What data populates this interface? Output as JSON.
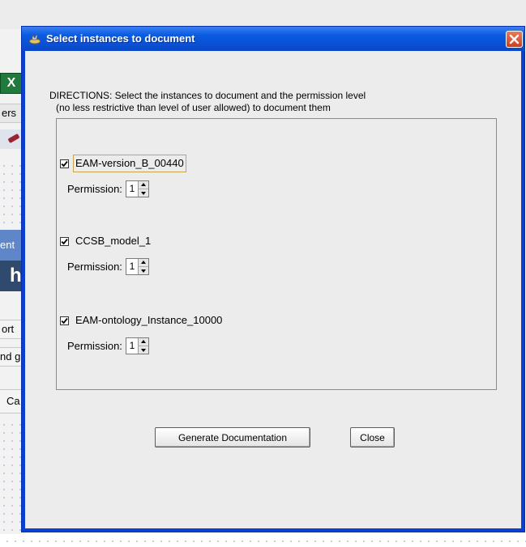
{
  "background": {
    "fragments": {
      "excel_icon_label": "X",
      "ers": "ers",
      "ent": "ent",
      "h": "h",
      "ort": "ort",
      "nd": "nd g",
      "ca": "Ca"
    }
  },
  "dialog": {
    "title": "Select instances to document",
    "directions_line1": "DIRECTIONS: Select the instances to document and the permission level",
    "directions_line2": "(no less restrictive than level of user allowed) to document them",
    "permission_label": "Permission:",
    "instances": [
      {
        "name": "EAM-version_B_00440",
        "checked": true,
        "permission": "1",
        "focused": true
      },
      {
        "name": "CCSB_model_1",
        "checked": true,
        "permission": "1",
        "focused": false
      },
      {
        "name": "EAM-ontology_Instance_10000",
        "checked": true,
        "permission": "1",
        "focused": false
      }
    ],
    "buttons": {
      "generate": "Generate Documentation",
      "close": "Close"
    }
  },
  "colors": {
    "titlebar": "#0a5be0",
    "close_button": "#c9401f",
    "client_background": "#ececec",
    "focus_border": "#c9a24a"
  }
}
